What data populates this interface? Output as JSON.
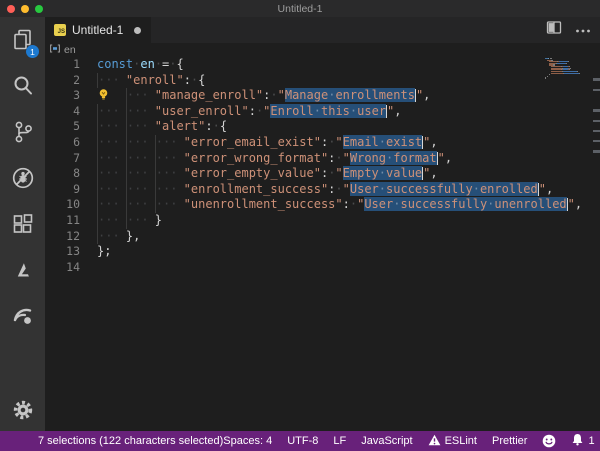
{
  "window": {
    "title": "Untitled-1"
  },
  "colors": {
    "status_bar": "#68217a",
    "selection": "#264f78",
    "badge": "#1d79cf",
    "js_file_icon": "#e8cf4e",
    "lightbulb": "#f3c030"
  },
  "activity_bar": {
    "badge_count": "1",
    "items": [
      "explorer",
      "search",
      "source-control",
      "debug",
      "extensions",
      "azure",
      "extension",
      "settings"
    ]
  },
  "tab": {
    "label": "Untitled-1",
    "modified": true
  },
  "breadcrumb": {
    "symbol": "en"
  },
  "editor": {
    "lines": [
      {
        "n": 1,
        "indent": 0,
        "tokens": [
          [
            "kw",
            "const"
          ],
          [
            "sp",
            " "
          ],
          [
            "var",
            "en"
          ],
          [
            "sp",
            " "
          ],
          [
            "op",
            "="
          ],
          [
            "sp",
            " "
          ],
          [
            "punc",
            "{"
          ]
        ]
      },
      {
        "n": 2,
        "indent": 4,
        "tokens": [
          [
            "str",
            "\"enroll\""
          ],
          [
            "punc",
            ":"
          ],
          [
            "sp",
            " "
          ],
          [
            "punc",
            "{"
          ]
        ]
      },
      {
        "n": 3,
        "indent": 8,
        "bulb": true,
        "tokens": [
          [
            "str",
            "\"manage_enroll\""
          ],
          [
            "punc",
            ":"
          ],
          [
            "sp",
            " "
          ],
          [
            "str",
            "\""
          ],
          [
            "sel",
            "Manage enrollments"
          ],
          [
            "cur",
            ""
          ],
          [
            "str",
            "\""
          ],
          [
            "punc",
            ","
          ]
        ]
      },
      {
        "n": 4,
        "indent": 8,
        "tokens": [
          [
            "str",
            "\"user_enroll\""
          ],
          [
            "punc",
            ":"
          ],
          [
            "sp",
            " "
          ],
          [
            "str",
            "\""
          ],
          [
            "sel",
            "Enroll this user"
          ],
          [
            "cur",
            ""
          ],
          [
            "str",
            "\""
          ],
          [
            "punc",
            ","
          ]
        ]
      },
      {
        "n": 5,
        "indent": 8,
        "tokens": [
          [
            "str",
            "\"alert\""
          ],
          [
            "punc",
            ":"
          ],
          [
            "sp",
            " "
          ],
          [
            "punc",
            "{"
          ]
        ]
      },
      {
        "n": 6,
        "indent": 12,
        "tokens": [
          [
            "str",
            "\"error_email_exist\""
          ],
          [
            "punc",
            ":"
          ],
          [
            "sp",
            " "
          ],
          [
            "str",
            "\""
          ],
          [
            "sel",
            "Email exist"
          ],
          [
            "cur",
            ""
          ],
          [
            "str",
            "\""
          ],
          [
            "punc",
            ","
          ]
        ]
      },
      {
        "n": 7,
        "indent": 12,
        "tokens": [
          [
            "str",
            "\"error_wrong_format\""
          ],
          [
            "punc",
            ":"
          ],
          [
            "sp",
            " "
          ],
          [
            "str",
            "\""
          ],
          [
            "sel",
            "Wrong format"
          ],
          [
            "cur",
            ""
          ],
          [
            "str",
            "\""
          ],
          [
            "punc",
            ","
          ]
        ]
      },
      {
        "n": 8,
        "indent": 12,
        "tokens": [
          [
            "str",
            "\"error_empty_value\""
          ],
          [
            "punc",
            ":"
          ],
          [
            "sp",
            " "
          ],
          [
            "str",
            "\""
          ],
          [
            "sel",
            "Empty value"
          ],
          [
            "cur",
            ""
          ],
          [
            "str",
            "\""
          ],
          [
            "punc",
            ","
          ]
        ]
      },
      {
        "n": 9,
        "indent": 12,
        "tokens": [
          [
            "str",
            "\"enrollment_success\""
          ],
          [
            "punc",
            ":"
          ],
          [
            "sp",
            " "
          ],
          [
            "str",
            "\""
          ],
          [
            "sel",
            "User successfully enrolled"
          ],
          [
            "cur",
            ""
          ],
          [
            "str",
            "\""
          ],
          [
            "punc",
            ","
          ]
        ]
      },
      {
        "n": 10,
        "indent": 12,
        "tokens": [
          [
            "str",
            "\"unenrollment_success\""
          ],
          [
            "punc",
            ":"
          ],
          [
            "sp",
            " "
          ],
          [
            "str",
            "\""
          ],
          [
            "sel",
            "User successfully unenrolled"
          ],
          [
            "cur",
            ""
          ],
          [
            "str",
            "\""
          ],
          [
            "punc",
            ","
          ]
        ]
      },
      {
        "n": 11,
        "indent": 8,
        "tokens": [
          [
            "punc",
            "}"
          ]
        ]
      },
      {
        "n": 12,
        "indent": 4,
        "tokens": [
          [
            "punc",
            "},"
          ]
        ]
      },
      {
        "n": 13,
        "indent": 0,
        "tokens": [
          [
            "punc",
            "};"
          ]
        ]
      },
      {
        "n": 14,
        "indent": 0,
        "tokens": []
      }
    ]
  },
  "status_bar": {
    "selection_info": "7 selections (122 characters selected)",
    "spaces": "Spaces: 4",
    "encoding": "UTF-8",
    "eol": "LF",
    "language": "JavaScript",
    "eslint": "ESLint",
    "prettier": "Prettier",
    "notification_count": "1"
  }
}
